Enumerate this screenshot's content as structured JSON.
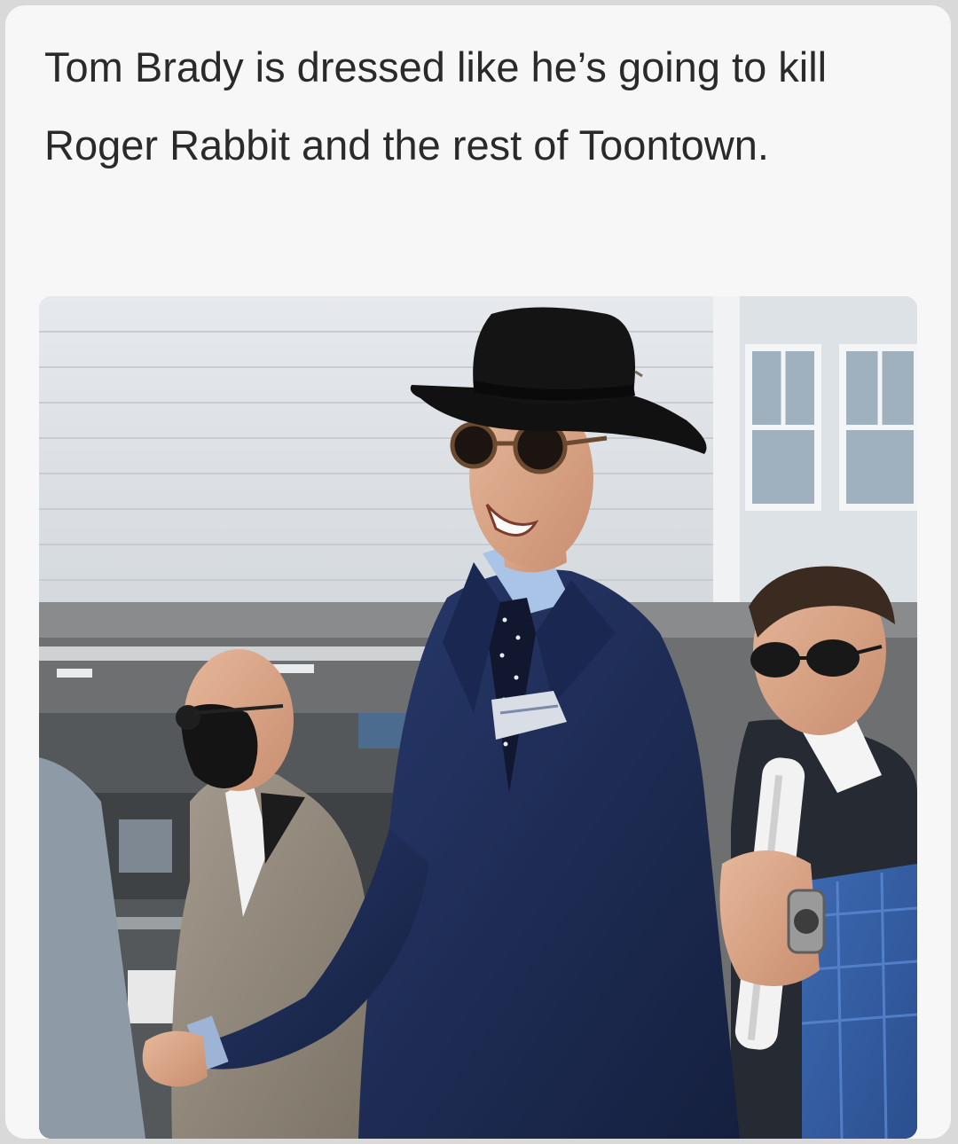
{
  "post": {
    "caption": "Tom Brady is dressed like he’s going to kill Roger Rabbit and the rest of Toontown."
  },
  "photo": {
    "scene": "outdoor-event",
    "subjects": [
      "man-in-black-hat",
      "bald-man-in-mask",
      "man-in-aviators"
    ]
  },
  "colors": {
    "background": "#d9d9d9",
    "card": "#f7f7f7",
    "caption_text": "#2a2a2a",
    "suit_navy": "#1c2a52",
    "hat_black": "#141414"
  }
}
